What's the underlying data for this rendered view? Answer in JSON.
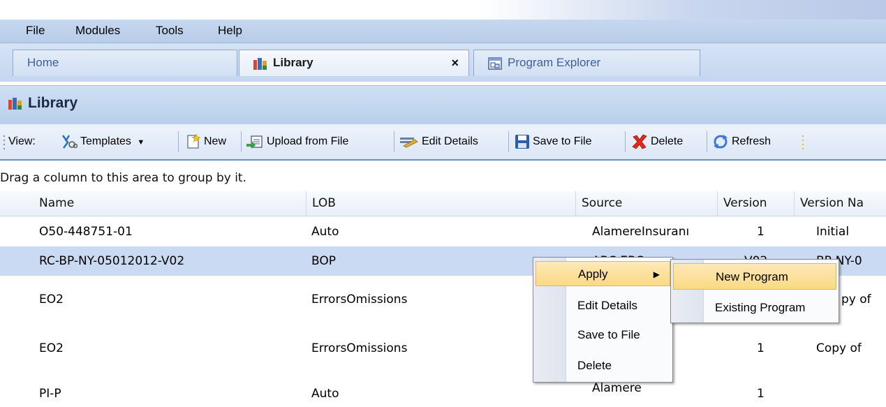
{
  "menu": {
    "items": [
      "File",
      "Modules",
      "Tools",
      "Help"
    ]
  },
  "tabs": {
    "home": "Home",
    "library": "Library",
    "library_close": "×",
    "explorer": "Program Explorer"
  },
  "panel": {
    "title": "Library"
  },
  "toolbar": {
    "view_label": "View:",
    "templates": "Templates",
    "new": "New",
    "upload": "Upload from File",
    "edit": "Edit Details",
    "save": "Save to File",
    "delete": "Delete",
    "refresh": "Refresh"
  },
  "grid": {
    "group_hint": "Drag a column to this area to group by it.",
    "columns": [
      "Name",
      "LOB",
      "Source",
      "Version",
      "Version Na"
    ],
    "rows": [
      {
        "name": "O50-448751-01",
        "lob": "Auto",
        "source": "AlamereInsuranı",
        "version": "1",
        "version_name": "Initial"
      },
      {
        "name": "RC-BP-NY-05012012-V02",
        "lob": "BOP",
        "source": "ABC EBC",
        "version": "V02",
        "version_name": "BP-NY-0"
      },
      {
        "name": "EO2",
        "lob": "ErrorsOmissions",
        "source": "",
        "version": "",
        "version_name": "py of"
      },
      {
        "name": "EO2",
        "lob": "ErrorsOmissions",
        "source": "",
        "version": "1",
        "version_name": "Copy of"
      },
      {
        "name": "PI-P",
        "lob": "Auto",
        "source": "Alamere",
        "version": "1",
        "version_name": ""
      }
    ]
  },
  "context_menu": {
    "items": [
      "Apply",
      "Edit Details",
      "Save to File",
      "Delete"
    ],
    "arrow": "▶"
  },
  "submenu": {
    "items": [
      "New Program",
      "Existing Program"
    ]
  },
  "colors": {
    "selection": "#c9daf2",
    "menu_highlight": "#fbd984",
    "header": "#b8cfeb"
  }
}
